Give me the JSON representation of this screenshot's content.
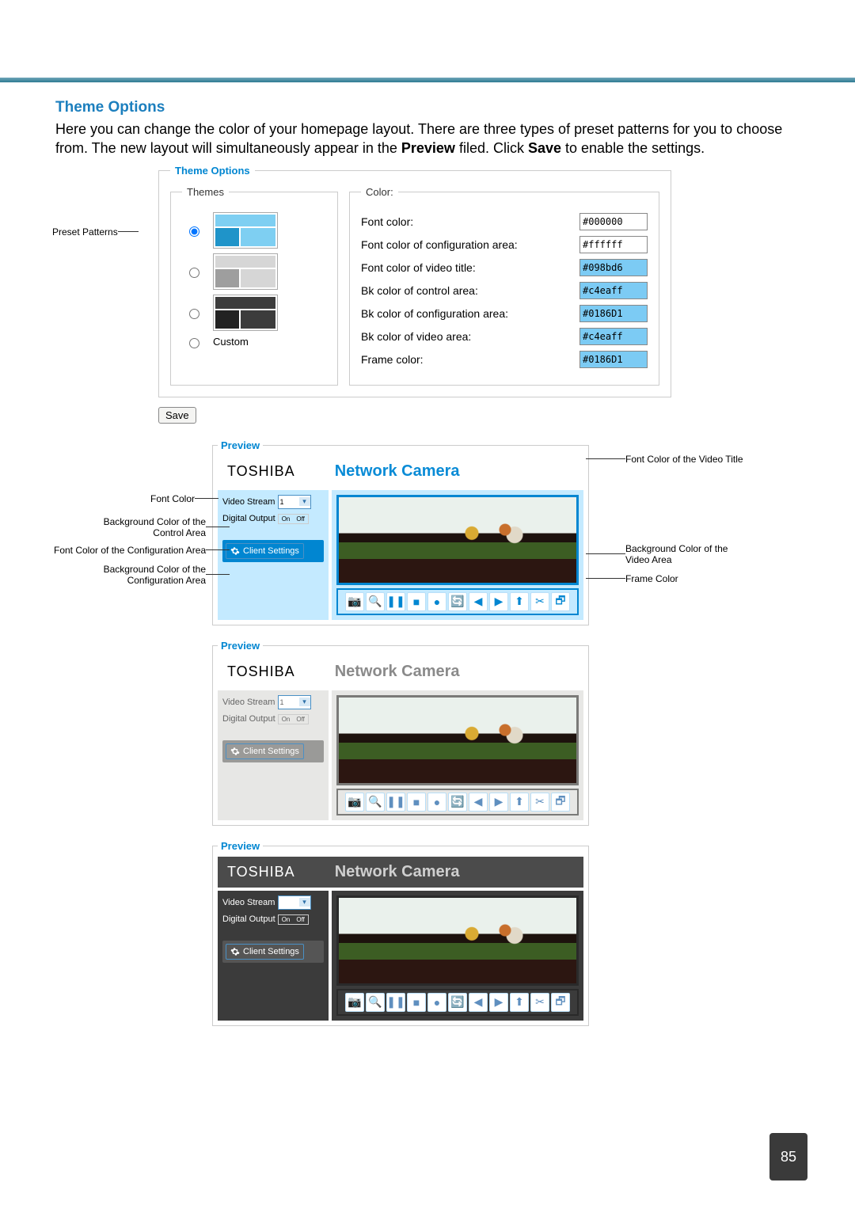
{
  "section_title": "Theme Options",
  "intro_part1": "Here you can change the color of your homepage layout. There are three types of preset patterns for you to choose from. The new layout will simultaneously appear in the ",
  "intro_bold1": "Preview",
  "intro_part2": " filed. Click ",
  "intro_bold2": "Save",
  "intro_part3": " to enable the settings.",
  "preset_label": "Preset Patterns",
  "theme_options_legend": "Theme Options",
  "themes_legend": "Themes",
  "custom_label": "Custom",
  "color_legend": "Color:",
  "colors": [
    {
      "label": "Font color:",
      "value": "#000000",
      "bg": "#ffffff"
    },
    {
      "label": "Font color of configuration area:",
      "value": "#ffffff",
      "bg": "#ffffff"
    },
    {
      "label": "Font color of video title:",
      "value": "#098bd6",
      "bg": "#7ccbf4"
    },
    {
      "label": "Bk color of control area:",
      "value": "#c4eaff",
      "bg": "#7ccbf4"
    },
    {
      "label": "Bk color of configuration area:",
      "value": "#0186D1",
      "bg": "#7ccbf4"
    },
    {
      "label": "Bk color of video area:",
      "value": "#c4eaff",
      "bg": "#7ccbf4"
    },
    {
      "label": "Frame color:",
      "value": "#0186D1",
      "bg": "#7ccbf4"
    }
  ],
  "save_label": "Save",
  "preview_legend": "Preview",
  "brand": "TOSHIBA",
  "title": "Network Camera",
  "controls": {
    "video_stream": "Video Stream",
    "stream_value": "1",
    "digital_output": "Digital Output",
    "on": "On",
    "off": "Off",
    "client_settings": "Client Settings"
  },
  "toolbar_icons": [
    "📷",
    "🔍",
    "❚❚",
    "■",
    "●",
    "🔄",
    "◀",
    "▶",
    "⬆",
    "✂",
    "🗗"
  ],
  "previews": [
    {
      "header_bg": "#ffffff",
      "font": "#000000",
      "title_color": "#098bd6",
      "control_bg": "#c4eaff",
      "conf_bg": "#0186D1",
      "conf_font": "#ffffff",
      "video_bg": "#c4eaff",
      "frame": "#0186D1",
      "tool_icon": "#0186D1"
    },
    {
      "header_bg": "#ffffff",
      "font": "#666666",
      "title_color": "#8a8a8a",
      "control_bg": "#e7e7e5",
      "conf_bg": "#9a9a98",
      "conf_font": "#ffffff",
      "video_bg": "#e7e7e5",
      "frame": "#7a7a78",
      "tool_icon": "#5f8fbf"
    },
    {
      "header_bg": "#4b4b4b",
      "font": "#ffffff",
      "title_color": "#cfcfcf",
      "control_bg": "#3b3b3b",
      "conf_bg": "#555555",
      "conf_font": "#ffffff",
      "video_bg": "#3b3b3b",
      "frame": "#2a2a2a",
      "tool_icon": "#5f8fbf",
      "brand_color": "#ffffff"
    }
  ],
  "annotations_left": [
    "Font Color",
    "Background Color of the Control Area",
    "Font Color of the Configuration Area",
    "Background Color of the Configuration Area"
  ],
  "annotations_right": [
    "Font Color of the Video Title",
    "Background Color of the Video Area",
    "Frame Color"
  ],
  "page_number": "85"
}
